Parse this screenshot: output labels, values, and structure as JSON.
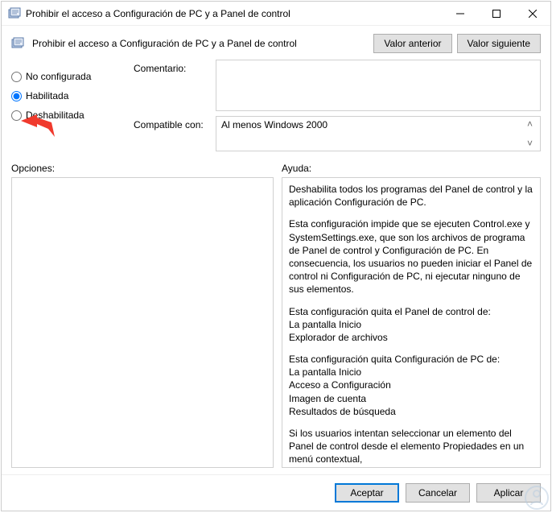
{
  "window": {
    "title": "Prohibir el acceso a Configuración de PC y a Panel de control"
  },
  "header": {
    "title": "Prohibir el acceso a Configuración de PC y a Panel de control",
    "prev": "Valor anterior",
    "next": "Valor siguiente"
  },
  "radios": {
    "not_configured": "No configurada",
    "enabled": "Habilitada",
    "disabled": "Deshabilitada",
    "selected": "enabled"
  },
  "fields": {
    "comment_label": "Comentario:",
    "comment_value": "",
    "compat_label": "Compatible con:",
    "compat_value": "Al menos Windows 2000"
  },
  "labels": {
    "options": "Opciones:",
    "help": "Ayuda:"
  },
  "help": {
    "p1": "Deshabilita todos los programas del Panel de control y la aplicación Configuración de PC.",
    "p2": "Esta configuración impide que se ejecuten Control.exe y SystemSettings.exe, que son los archivos de programa de Panel de control y Configuración de PC. En consecuencia, los usuarios no pueden iniciar el Panel de control ni Configuración de PC, ni ejecutar ninguno de sus elementos.",
    "p3": "Esta configuración quita el Panel de control de:",
    "p3a": "La pantalla Inicio",
    "p3b": "Explorador de archivos",
    "p4": "Esta configuración quita Configuración de PC de:",
    "p4a": "La pantalla Inicio",
    "p4b": "Acceso a Configuración",
    "p4c": "Imagen de cuenta",
    "p4d": "Resultados de búsqueda",
    "p5": "Si los usuarios intentan seleccionar un elemento del Panel de control desde el elemento Propiedades en un menú contextual,"
  },
  "footer": {
    "ok": "Aceptar",
    "cancel": "Cancelar",
    "apply": "Aplicar"
  }
}
